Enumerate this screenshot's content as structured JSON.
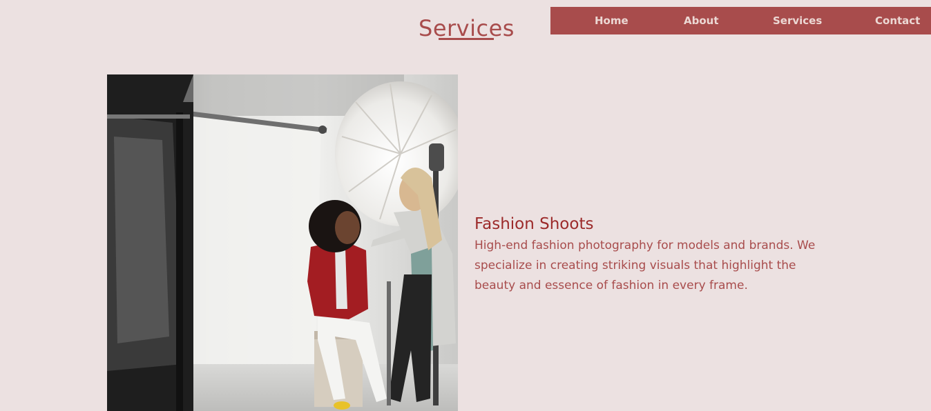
{
  "nav": {
    "home_label": "Home",
    "about_label": "About",
    "services_label": "Services",
    "contact_label": "Contact"
  },
  "page": {
    "title": "Services"
  },
  "service": {
    "heading": "Fashion Shoots",
    "description": "High-end fashion photography for models and brands. We specialize in creating striking visuals that highlight the beauty and essence of fashion in every frame."
  },
  "colors": {
    "background": "#ece1e1",
    "accent": "#a84c4c",
    "heading": "#9c2a2a",
    "nav_text": "#ecd8d4"
  }
}
